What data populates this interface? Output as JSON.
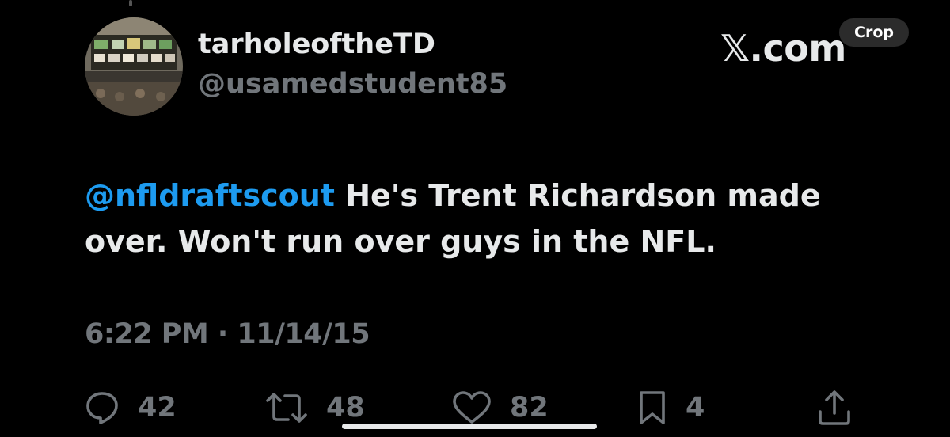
{
  "author": {
    "display_name": "tarholeoftheTD",
    "handle": "@usamedstudent85",
    "avatar_icon": "avatar-photo-sportsbook"
  },
  "brand": {
    "label": "𝕏.com"
  },
  "crop_button": {
    "label": "Crop"
  },
  "tweet": {
    "mention": "@nfldraftscout",
    "text": " He's Trent Richardson made over. Won't run over guys in the NFL.",
    "timestamp": "6:22 PM · 11/14/15"
  },
  "actions": {
    "replies": "42",
    "retweets": "48",
    "likes": "82",
    "bookmarks": "4"
  },
  "colors": {
    "background": "#000000",
    "text": "#e7e9ea",
    "secondary": "#71767b",
    "link": "#1d9bf0"
  }
}
